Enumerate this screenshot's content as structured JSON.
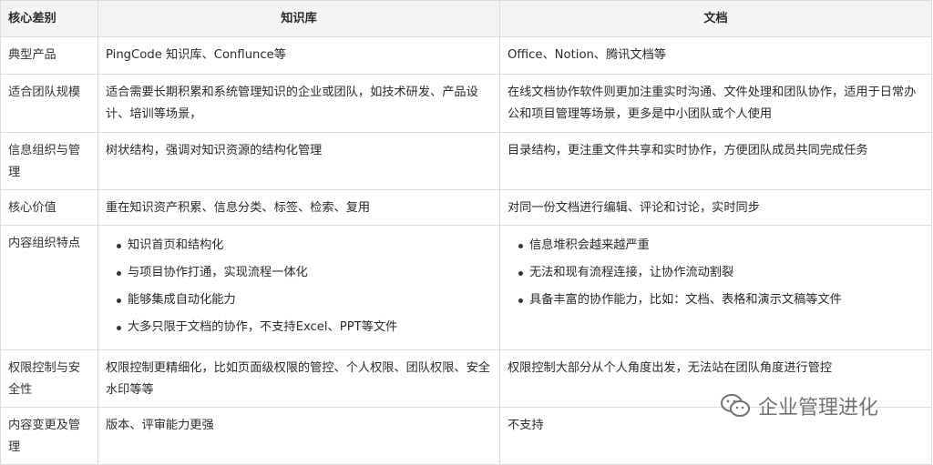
{
  "table": {
    "headers": [
      "核心差别",
      "知识库",
      "文档"
    ],
    "rows": [
      {
        "label": "典型产品",
        "kb": "PingCode 知识库、Conflunce等",
        "doc": "Office、Notion、腾讯文档等"
      },
      {
        "label": "适合团队规模",
        "kb": "适合需要长期积累和系统管理知识的企业或团队，如技术研发、产品设计、培训等场景，",
        "doc": "在线文档协作软件则更加注重实时沟通、文件处理和团队协作，适用于日常办公和项目管理等场景，更多是中小团队或个人使用"
      },
      {
        "label": "信息组织与管理",
        "kb": "树状结构，强调对知识资源的结构化管理",
        "doc": "目录结构，更注重文件共享和实时协作，方便团队成员共同完成任务"
      },
      {
        "label": "核心价值",
        "kb": "重在知识资产积累、信息分类、标签、检索、复用",
        "doc": "对同一份文档进行编辑、评论和讨论，实时同步"
      },
      {
        "label": "内容组织特点",
        "kb_list": [
          "知识首页和结构化",
          "与项目协作打通，实现流程一体化",
          "能够集成自动化能力",
          "大多只限于文档的协作，不支持Excel、PPT等文件"
        ],
        "doc_list": [
          "信息堆积会越来越严重",
          "无法和现有流程连接，让协作流动割裂",
          "具备丰富的协作能力，比如：文档、表格和演示文稿等文件"
        ]
      },
      {
        "label": "权限控制与安全性",
        "kb": "权限控制更精细化，比如页面级权限的管控、个人权限、团队权限、安全水印等等",
        "doc": "权限控制大部分从个人角度出发，无法站在团队角度进行管控"
      },
      {
        "label": "内容变更及管理",
        "kb": "版本、评审能力更强",
        "doc": "不支持"
      }
    ]
  },
  "watermark": {
    "text": "企业管理进化",
    "icon": "wechat-icon"
  }
}
